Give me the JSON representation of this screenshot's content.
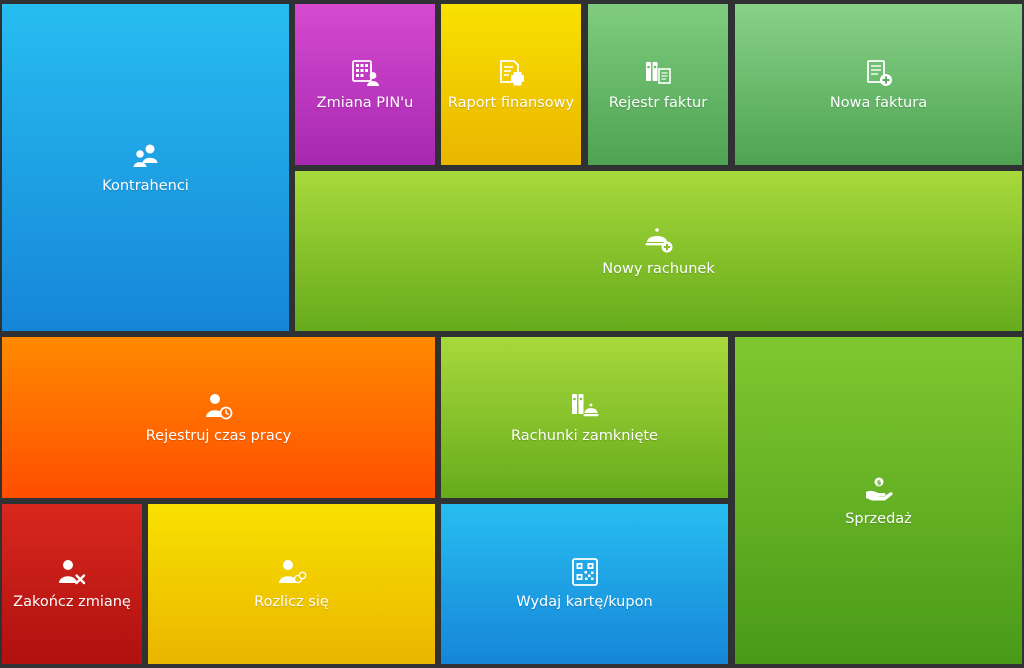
{
  "tiles": {
    "kontrahenci": {
      "label": "Kontrahenci",
      "icon": "users-icon",
      "color": "#1fa3e6"
    },
    "zmiana_pin": {
      "label": "Zmiana PIN'u",
      "icon": "keypad-user-icon",
      "color": "#c23bc4"
    },
    "raport": {
      "label": "Raport finansowy",
      "icon": "report-printer-icon",
      "color": "#f2ca00"
    },
    "rejestr": {
      "label": "Rejestr faktur",
      "icon": "binders-invoice-icon",
      "color": "#66b866"
    },
    "nowa_faktura": {
      "label": "Nowa faktura",
      "icon": "invoice-add-icon",
      "color": "#6cbb6e"
    },
    "nowy_rachunek": {
      "label": "Nowy rachunek",
      "icon": "cloche-add-icon",
      "color": "#88c22c"
    },
    "czas_pracy": {
      "label": "Rejestruj czas pracy",
      "icon": "user-clock-icon",
      "color": "#ff6a00"
    },
    "zamkniete": {
      "label": "Rachunki zamknięte",
      "icon": "binders-cloche-icon",
      "color": "#88c22c"
    },
    "sprzedaz": {
      "label": "Sprzedaż",
      "icon": "hand-coin-icon",
      "color": "#64b224"
    },
    "zakoncz": {
      "label": "Zakończ zmianę",
      "icon": "user-remove-icon",
      "color": "#c41c16"
    },
    "rozlicz": {
      "label": "Rozlicz się",
      "icon": "user-coins-icon",
      "color": "#f2ca00"
    },
    "karta": {
      "label": "Wydaj kartę/kupon",
      "icon": "qr-card-icon",
      "color": "#1fa3e6"
    }
  }
}
